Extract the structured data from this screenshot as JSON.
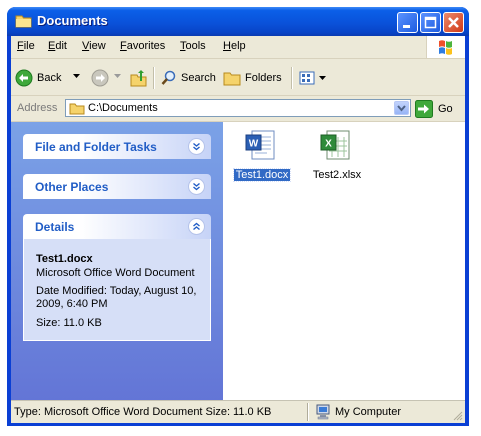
{
  "window": {
    "title": "Documents"
  },
  "menu": {
    "items": [
      {
        "label": "File"
      },
      {
        "label": "Edit"
      },
      {
        "label": "View"
      },
      {
        "label": "Favorites"
      },
      {
        "label": "Tools"
      },
      {
        "label": "Help"
      }
    ]
  },
  "toolbar": {
    "back_label": "Back",
    "search_label": "Search",
    "folders_label": "Folders"
  },
  "address": {
    "label": "Address",
    "value": "C:\\Documents",
    "go_label": "Go"
  },
  "sidebar": {
    "file_folder_tasks": "File and Folder Tasks",
    "other_places": "Other Places",
    "details": {
      "heading": "Details",
      "filename": "Test1.docx",
      "type": "Microsoft Office Word Document",
      "date_modified": "Date Modified: Today, August 10, 2009, 6:40 PM",
      "size": "Size: 11.0 KB"
    }
  },
  "files": [
    {
      "name": "Test1.docx",
      "icon": "word-document-icon",
      "selected": true
    },
    {
      "name": "Test2.xlsx",
      "icon": "excel-workbook-icon",
      "selected": false
    }
  ],
  "status": {
    "left_text": "Type: Microsoft Office Word Document Size: 11.0 KB",
    "zone_text": "My Computer"
  },
  "colors": {
    "titlebar": "#0a52da",
    "sidebar_gradient_top": "#7ba2e7",
    "sidebar_gradient_bottom": "#6375d6",
    "panel_heading_text": "#215dc6",
    "selection": "#316ac5"
  }
}
